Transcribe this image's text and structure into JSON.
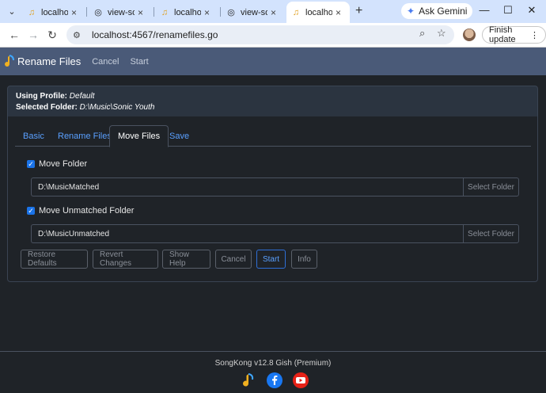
{
  "browser": {
    "tabs": [
      {
        "label": "localhost",
        "icon": "songkong-icon",
        "active": false
      },
      {
        "label": "view-sou",
        "icon": "globe-icon",
        "active": false
      },
      {
        "label": "localhost",
        "icon": "songkong-icon",
        "active": false
      },
      {
        "label": "view-sou",
        "icon": "globe-icon",
        "active": false
      },
      {
        "label": "localhost",
        "icon": "songkong-icon",
        "active": true
      }
    ],
    "ask_gemini": "Ask Gemini",
    "url": "localhost:4567/renamefiles.go",
    "finish_update": "Finish update"
  },
  "app": {
    "brand": "Rename Files",
    "nav_links": [
      "Cancel",
      "Start"
    ],
    "using_profile_label": "Using Profile:",
    "using_profile_value": "Default",
    "selected_folder_label": "Selected Folder:",
    "selected_folder_value": "D:\\Music\\Sonic Youth",
    "tabs": [
      "Basic",
      "Rename Files",
      "Move Files",
      "Save"
    ],
    "active_tab": "Move Files",
    "move_folder": {
      "label": "Move Folder",
      "checked": true,
      "path": "D:\\MusicMatched",
      "button": "Select Folder"
    },
    "move_unmatched": {
      "label": "Move Unmatched Folder",
      "checked": true,
      "path": "D:\\MusicUnmatched",
      "button": "Select Folder"
    },
    "buttons": [
      "Restore Defaults",
      "Revert Changes",
      "Show Help",
      "Cancel",
      "Start",
      "Info"
    ],
    "footer": "SongKong v12.8 Gish (Premium)"
  },
  "colors": {
    "navbar": "#4a5a78",
    "background": "#1f2328",
    "link": "#5aa0ff",
    "checkbox": "#1a73e8",
    "facebook": "#1877f2",
    "youtube": "#e62117"
  }
}
